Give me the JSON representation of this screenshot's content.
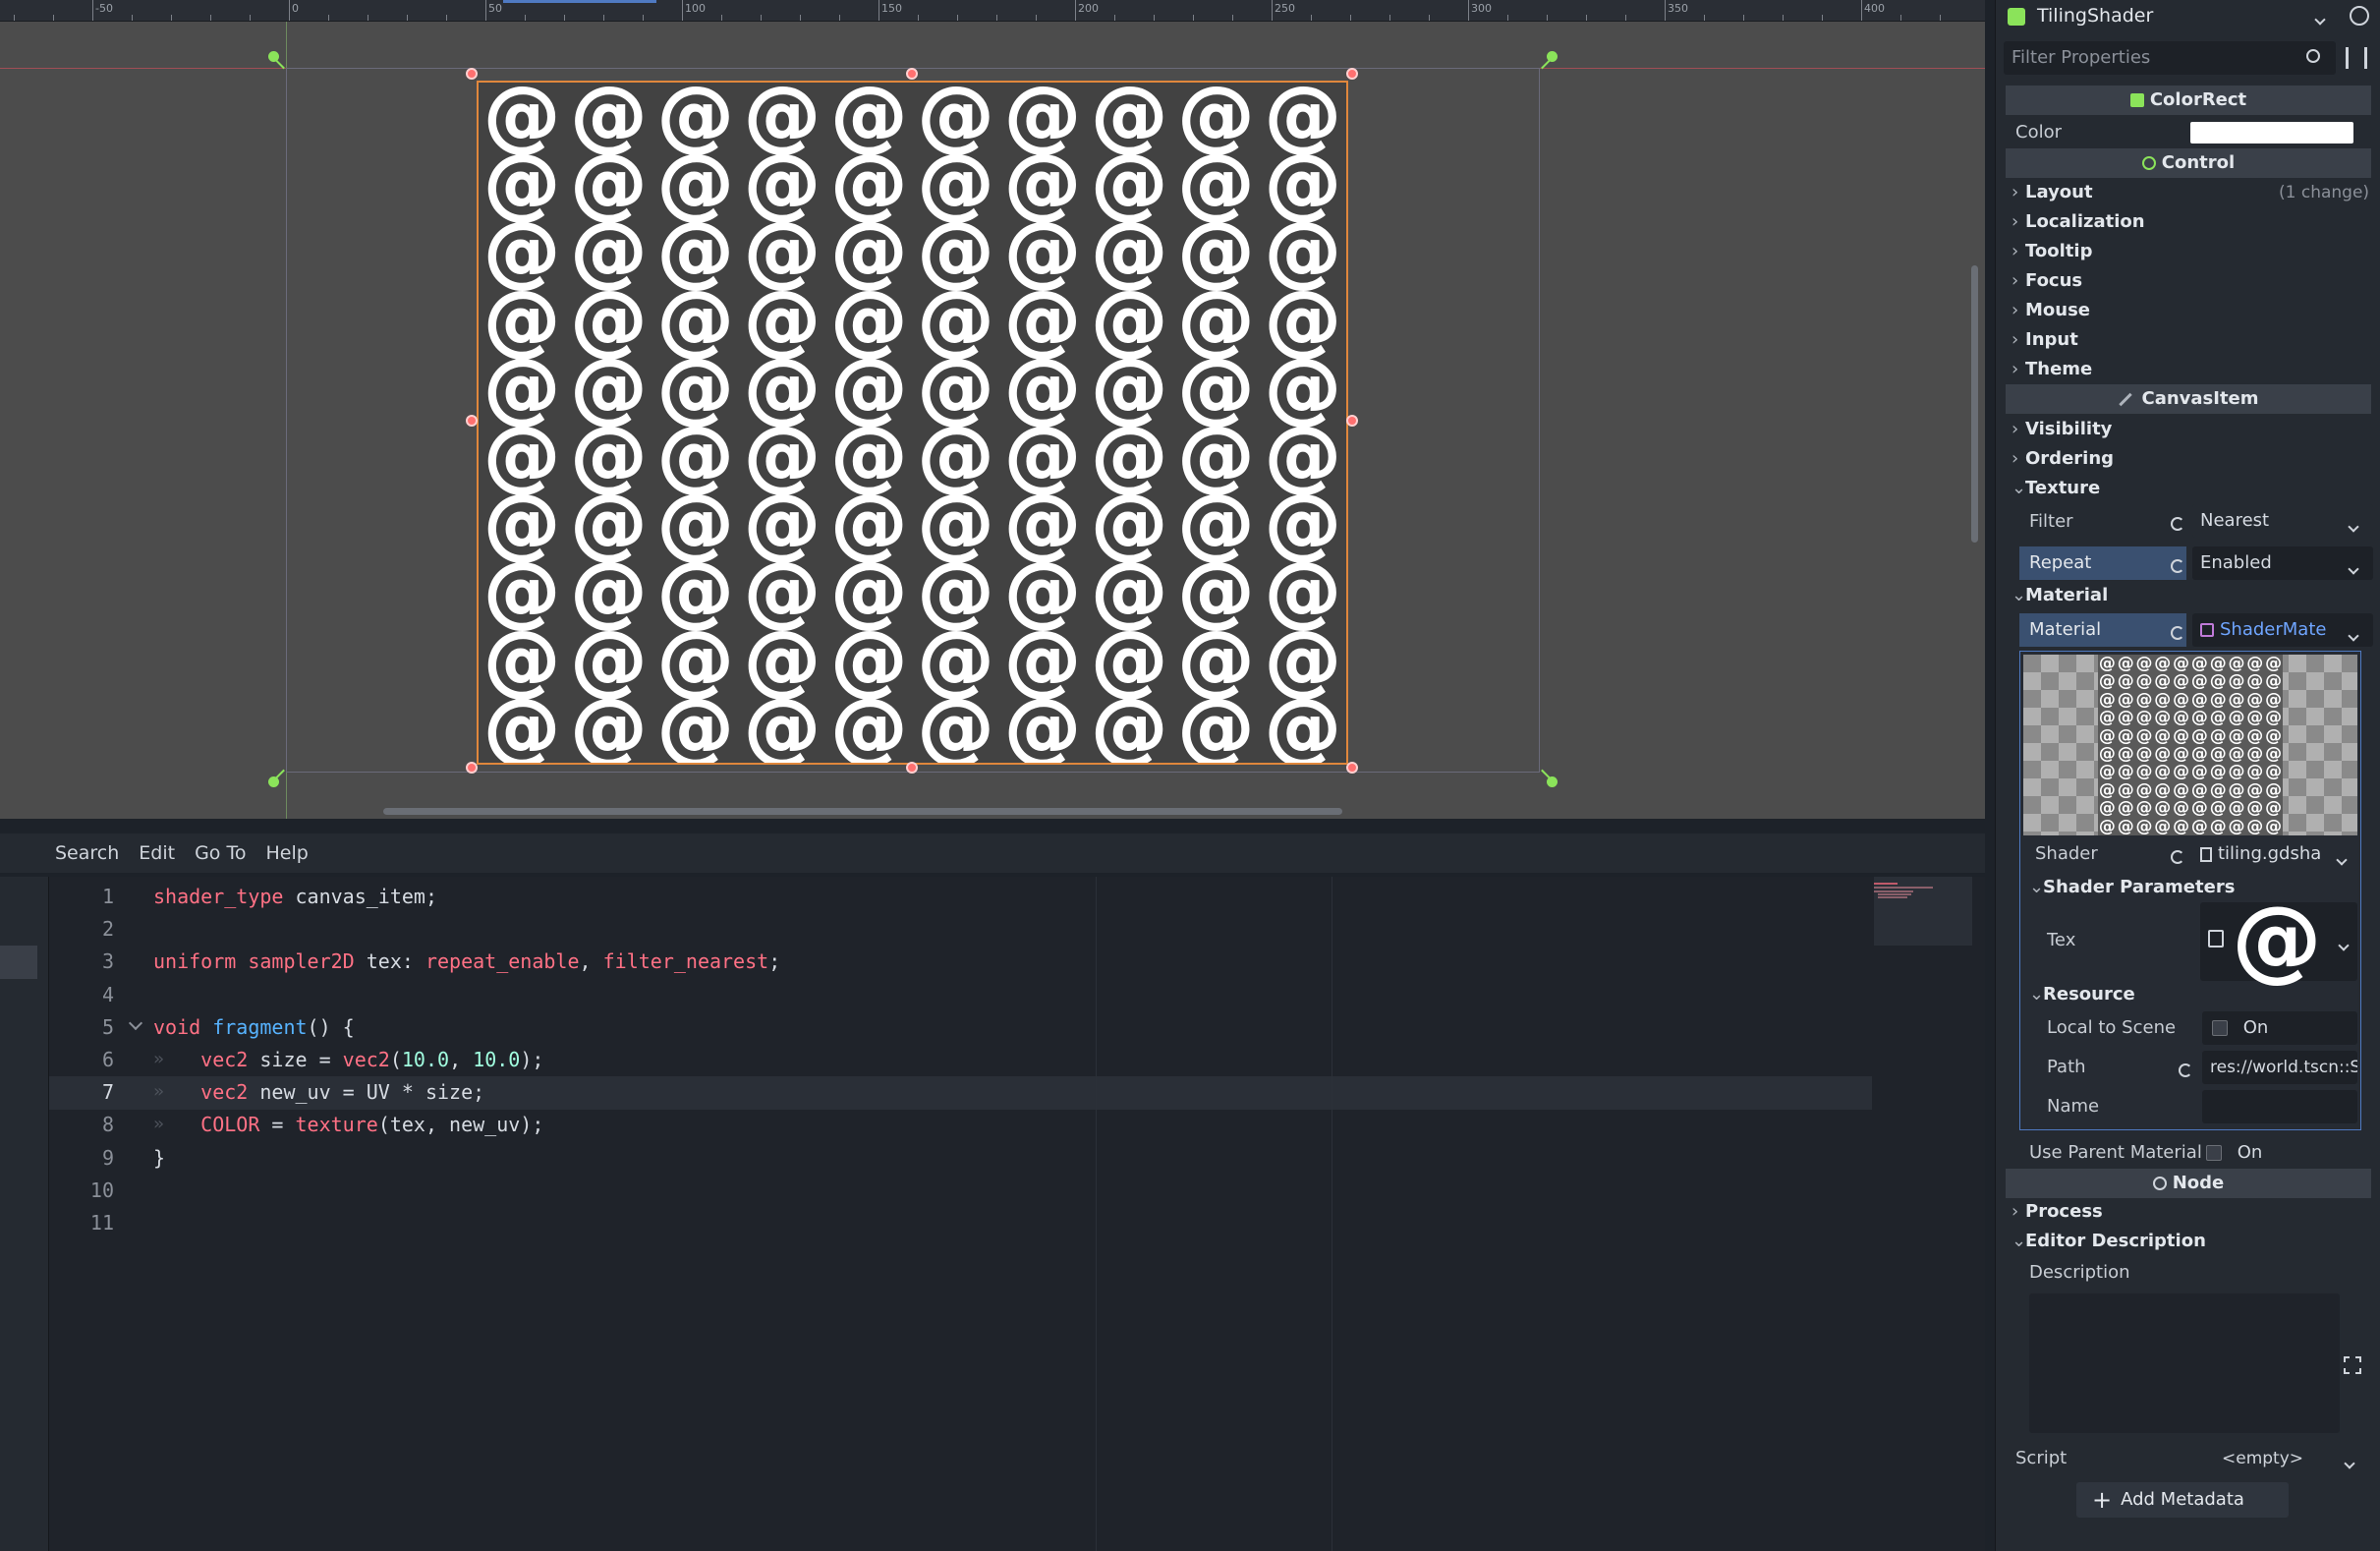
{
  "viewport": {
    "ruler_labels": [
      "-50",
      "0",
      "50",
      "100",
      "150",
      "200",
      "250",
      "300",
      "350",
      "400"
    ],
    "tile_glyph": "@",
    "tile_cols": 10,
    "tile_rows": 10
  },
  "editor": {
    "menus": [
      "Search",
      "Edit",
      "Go To",
      "Help"
    ],
    "line_numbers": [
      "1",
      "2",
      "3",
      "4",
      "5",
      "6",
      "7",
      "8",
      "9",
      "10",
      "11"
    ],
    "lines": [
      [
        {
          "t": "kw",
          "v": "shader_type"
        },
        {
          "t": "tx",
          "v": " canvas_item;"
        }
      ],
      [],
      [
        {
          "t": "kw",
          "v": "uniform"
        },
        {
          "t": "tx",
          "v": " "
        },
        {
          "t": "kw",
          "v": "sampler2D"
        },
        {
          "t": "tx",
          "v": " tex: "
        },
        {
          "t": "kw",
          "v": "repeat_enable"
        },
        {
          "t": "tx",
          "v": ", "
        },
        {
          "t": "kw",
          "v": "filter_nearest"
        },
        {
          "t": "tx",
          "v": ";"
        }
      ],
      [],
      [
        {
          "t": "kw",
          "v": "void"
        },
        {
          "t": "tx",
          "v": " "
        },
        {
          "t": "fn",
          "v": "fragment"
        },
        {
          "t": "tx",
          "v": "() {"
        }
      ],
      [
        {
          "t": "tx",
          "v": "    "
        },
        {
          "t": "kw",
          "v": "vec2"
        },
        {
          "t": "tx",
          "v": " size = "
        },
        {
          "t": "kw",
          "v": "vec2"
        },
        {
          "t": "tx",
          "v": "("
        },
        {
          "t": "num",
          "v": "10.0"
        },
        {
          "t": "tx",
          "v": ", "
        },
        {
          "t": "num",
          "v": "10.0"
        },
        {
          "t": "tx",
          "v": ");"
        }
      ],
      [
        {
          "t": "tx",
          "v": "    "
        },
        {
          "t": "kw",
          "v": "vec2"
        },
        {
          "t": "tx",
          "v": " new_uv = UV * size;"
        }
      ],
      [
        {
          "t": "tx",
          "v": "    "
        },
        {
          "t": "kw",
          "v": "COLOR"
        },
        {
          "t": "tx",
          "v": " = "
        },
        {
          "t": "kw",
          "v": "texture"
        },
        {
          "t": "tx",
          "v": "(tex, new_uv);"
        }
      ],
      [
        {
          "t": "tx",
          "v": "}"
        }
      ],
      [],
      []
    ]
  },
  "inspector": {
    "node_name": "TilingShader",
    "filter_placeholder": "Filter Properties",
    "cat_colorrect": "ColorRect",
    "color_label": "Color",
    "cat_control": "Control",
    "sections_control": [
      "Layout",
      "Localization",
      "Tooltip",
      "Focus",
      "Mouse",
      "Input",
      "Theme"
    ],
    "layout_changes": "(1 change)",
    "cat_canvasitem": "CanvasItem",
    "visibility": "Visibility",
    "ordering": "Ordering",
    "texture": "Texture",
    "filter_label": "Filter",
    "filter_value": "Nearest",
    "repeat_label": "Repeat",
    "repeat_value": "Enabled",
    "material_section": "Material",
    "material_label": "Material",
    "material_value": "ShaderMate",
    "shader_label": "Shader",
    "shader_value": "tiling.gdsha",
    "shader_params": "Shader Parameters",
    "tex_label": "Tex",
    "tex_glyph": "@",
    "resource": "Resource",
    "local_to_scene": "Local to Scene",
    "on": "On",
    "path_label": "Path",
    "path_value": "res://world.tscn::S",
    "name_label": "Name",
    "use_parent_material": "Use Parent Material",
    "cat_node": "Node",
    "process": "Process",
    "editor_description": "Editor Description",
    "description_label": "Description",
    "script_label": "Script",
    "script_value": "<empty>",
    "add_metadata": "Add Metadata",
    "colors": {
      "accent": "#4f7ac2",
      "selection": "#e0873c",
      "handle": "#ff7070",
      "anchor": "#8be35a"
    }
  }
}
